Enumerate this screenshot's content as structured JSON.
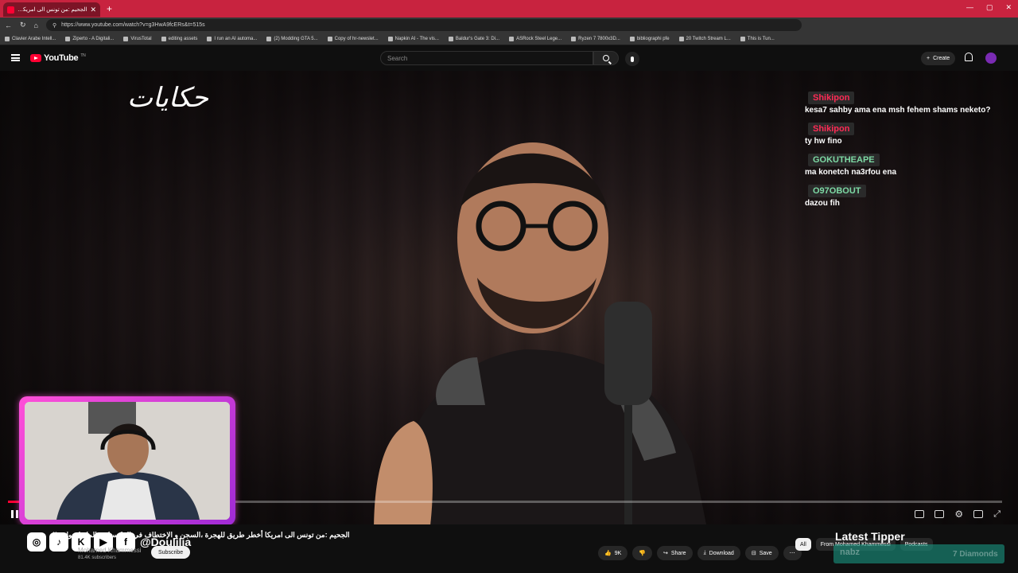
{
  "browser": {
    "tab_title": "الجحيم :من تونس الى امريكا أ...",
    "url": "https://www.youtube.com/watch?v=g3HwA9fcERs&t=515s",
    "bookmarks": [
      "Clavier Arabe Intell...",
      "Ziperto - A Digitali...",
      "VirusTotal",
      "editing assets",
      "I run an AI automa...",
      "(2) Modding GTA 5...",
      "Copy of hr-newslet...",
      "Napkin AI - The vis...",
      "Baldur's Gate 3: Di...",
      "ASRock Steel Lege...",
      "Ryzen 7 7800x3D...",
      "bibliographi pfe",
      "20 Twitch Stream L...",
      "This is Tun..."
    ]
  },
  "youtube": {
    "logo_text": "YouTube",
    "logo_region": "TN",
    "search_placeholder": "Search",
    "create_label": "Create"
  },
  "video": {
    "brand_arabic": "حكايات",
    "progress_fraction": 0.02,
    "title": "الجحيم :من تونس الى امريكا أخطر طريق للهجرة ،السجن و الإختطاف في المكسيك و المافيا حول...!!",
    "channel_name": "Mohamed Khammessi",
    "subscribers": "81.4K subscribers",
    "subscribe_label": "Subscribe",
    "like_count": "9K",
    "share_label": "Share",
    "download_label": "Download",
    "save_label": "Save"
  },
  "chat": [
    {
      "user": "Shikipon",
      "color": "#ff2a55",
      "text": "kesa7 sahby ama ena msh fehem shams neketo?"
    },
    {
      "user": "Shikipon",
      "color": "#ff2a55",
      "text": "ty hw fino"
    },
    {
      "user": "GOKUTHEAPE",
      "color": "#7dd9a4",
      "text": "ma konetch na3rfou ena"
    },
    {
      "user": "O97OBOUT",
      "color": "#7dd9a4",
      "text": "dazou fih"
    }
  ],
  "overlay": {
    "handle": "@Doulilia",
    "latest_tipper_label": "Latest Tipper",
    "tipper_name": "nabz",
    "tipper_amount": "7 Diamonds"
  },
  "chips": [
    "All",
    "From Mohamed Khammessi",
    "Podcasts"
  ]
}
